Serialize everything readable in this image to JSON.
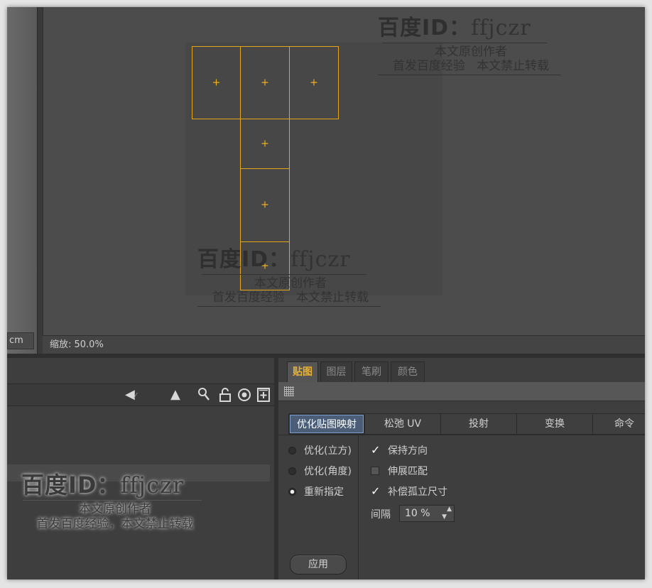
{
  "left_panel": {
    "unit_field": "cm"
  },
  "uv_view": {
    "zoom_text": "缩放: 50.0%"
  },
  "tool_icons": [
    "arrow-left-icon",
    "arrow-up-icon",
    "magnifier-icon",
    "lock-icon",
    "target-icon",
    "add-box-icon"
  ],
  "tabs": [
    {
      "label": "贴图",
      "active": true
    },
    {
      "label": "图层",
      "active": false
    },
    {
      "label": "笔刷",
      "active": false
    },
    {
      "label": "颜色",
      "active": false
    }
  ],
  "command_tabs": [
    {
      "label": "优化贴图映射",
      "active": true
    },
    {
      "label": "松弛 UV",
      "active": false
    },
    {
      "label": "投射",
      "active": false
    },
    {
      "label": "变换",
      "active": false
    },
    {
      "label": "命令",
      "active": false
    }
  ],
  "radio_options": [
    {
      "label": "优化(立方)",
      "selected": false
    },
    {
      "label": "优化(角度)",
      "selected": false
    },
    {
      "label": "重新指定",
      "selected": true
    }
  ],
  "check_options": [
    {
      "label": "保持方向",
      "checked": true
    },
    {
      "label": "伸展匹配",
      "checked": false
    },
    {
      "label": "补偿孤立尺寸",
      "checked": true
    }
  ],
  "check_mark": "✓",
  "spacing": {
    "label": "间隔",
    "value": "10 %"
  },
  "apply_label": "应用",
  "watermark": {
    "title": "百度ID：",
    "id": "ffjczr",
    "line1": "本文原创作者",
    "line2_a": "首发百度经验",
    "line2_b": "本文禁止转载",
    "line2_joined": "首发百度经验，本文禁止转载"
  }
}
